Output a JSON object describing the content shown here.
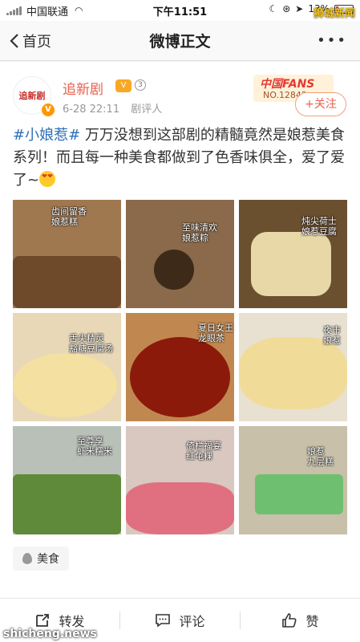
{
  "status_bar": {
    "carrier": "中国联通",
    "time": "下午11:51",
    "battery_text": "13%",
    "watermark": "狮城新闻"
  },
  "nav": {
    "back_label": "首页",
    "title": "微博正文",
    "more_label": "•••"
  },
  "post": {
    "author": "追新剧",
    "avatar_text": "追新剧",
    "vip_badge": "V",
    "level_badge": "3",
    "date": "6-28 22:11",
    "source": "剧评人",
    "fans_badge_title": "中国FANS",
    "fans_badge_no": "NO.12842",
    "follow_label": "+关注",
    "topic": "#小娘惹#",
    "body": " 万万没想到这部剧的精髓竟然是娘惹美食系列！而且每一种美食都做到了色香味俱全，爱了爱了~"
  },
  "images": [
    {
      "caption": "齿间留香\n娘惹糕",
      "bg": "#a07850"
    },
    {
      "caption": "至味清欢\n娘惹粽",
      "bg": "#8a6a4a"
    },
    {
      "caption": "炖尖荷士\n娘惹豆腐",
      "bg": "#6b5030"
    },
    {
      "caption": "舌尖精灵\n豁糖豆腐汤",
      "bg": "#e8d8b8"
    },
    {
      "caption": "夏日女王\n龙眼茶",
      "bg": "#c08850"
    },
    {
      "caption": "夜市\n娘惹",
      "bg": "#e8e0d0"
    },
    {
      "caption": "至尊享\n虾米糯米",
      "bg": "#b8c0b8"
    },
    {
      "caption": "倚栏福宴\n红龟粿",
      "bg": "#d8c8c0"
    },
    {
      "caption": "娘惹\n九层糕",
      "bg": "#c8c0a8"
    }
  ],
  "tag": {
    "label": "美食"
  },
  "actions": {
    "repost": "转发",
    "comment": "评论",
    "like": "赞"
  },
  "bottom_watermark": "shicheng.news",
  "colors": {
    "author": "#e8604c",
    "topic": "#2e6fb8",
    "follow_border": "#f0a080"
  }
}
